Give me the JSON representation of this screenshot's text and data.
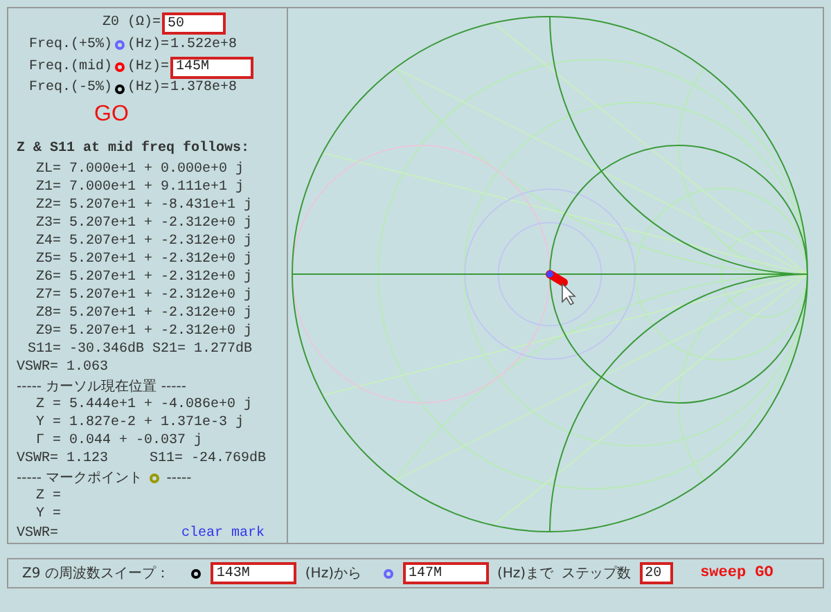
{
  "z0": {
    "label": "Z0 (Ω)=",
    "value": "50"
  },
  "freqs": [
    {
      "kind": "readout",
      "label": "Freq.(+5%)",
      "color": "#6666ff",
      "unit": "(Hz)=",
      "value": "1.522e+8"
    },
    {
      "kind": "input",
      "label": "Freq.(mid)",
      "color": "#ff0000",
      "unit": "(Hz)=",
      "value": "145M"
    },
    {
      "kind": "readout",
      "label": "Freq.(-5%)",
      "color": "#000000",
      "unit": "(Hz)=",
      "value": "1.378e+8"
    }
  ],
  "go": "GO",
  "results": {
    "heading": "Z & S11 at mid freq follows:",
    "lines": [
      {
        "kind": "z",
        "text": "ZL= 7.000e+1 + 0.000e+0 j"
      },
      {
        "kind": "z",
        "text": "Z1= 7.000e+1 + 9.111e+1 j"
      },
      {
        "kind": "z",
        "text": "Z2= 5.207e+1 + -8.431e+1 j"
      },
      {
        "kind": "z",
        "text": "Z3= 5.207e+1 + -2.312e+0 j"
      },
      {
        "kind": "z",
        "text": "Z4= 5.207e+1 + -2.312e+0 j"
      },
      {
        "kind": "z",
        "text": "Z5= 5.207e+1 + -2.312e+0 j"
      },
      {
        "kind": "z",
        "text": "Z6= 5.207e+1 + -2.312e+0 j"
      },
      {
        "kind": "z",
        "text": "Z7= 5.207e+1 + -2.312e+0 j"
      },
      {
        "kind": "z",
        "text": "Z8= 5.207e+1 + -2.312e+0 j"
      },
      {
        "kind": "z",
        "text": "Z9= 5.207e+1 + -2.312e+0 j"
      },
      {
        "kind": "s",
        "text": "S11= -30.346dB S21= 1.277dB"
      },
      {
        "kind": "v",
        "text": "VSWR= 1.063"
      }
    ]
  },
  "cursor": {
    "heading": "----- カーソル現在位置 -----",
    "lines": [
      {
        "kind": "z",
        "text": "Z = 5.444e+1 + -4.086e+0 j"
      },
      {
        "kind": "z",
        "text": "Y = 1.827e-2 + 1.371e-3 j"
      },
      {
        "kind": "z",
        "text": "Γ = 0.044 + -0.037 j"
      },
      {
        "kind": "v",
        "text": "VSWR= 1.123     S11= -24.769dB"
      }
    ]
  },
  "mark": {
    "heading": "----- マークポイント",
    "color": "#999900",
    "tail": "-----",
    "lines": [
      {
        "kind": "z",
        "text": "Z ="
      },
      {
        "kind": "z",
        "text": "Y ="
      },
      {
        "kind": "v",
        "text": "VSWR="
      }
    ],
    "clear": "clear mark"
  },
  "sweep": {
    "label": "Z9 の周波数スイープ：",
    "ends": [
      {
        "color": "#000000",
        "value": "143M",
        "unit": "(Hz)から"
      },
      {
        "color": "#6666ff",
        "value": "147M",
        "unit": "(Hz)まで"
      }
    ],
    "steps_label": "ステップ数",
    "steps": "20",
    "go": "sweep GO"
  }
}
